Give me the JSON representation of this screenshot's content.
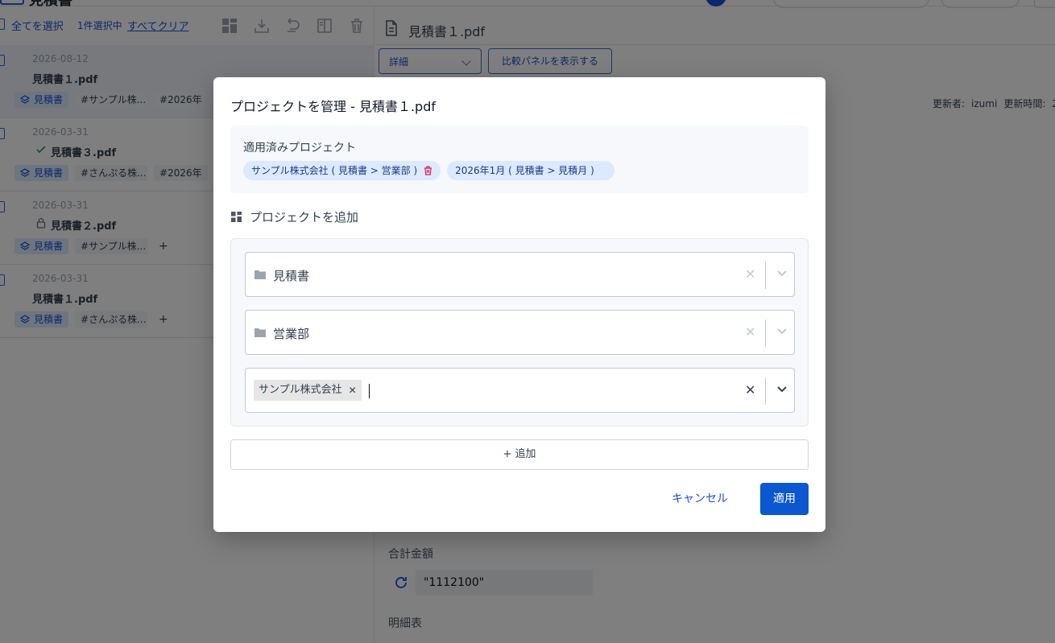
{
  "app": {
    "title": "見積書"
  },
  "left_panel": {
    "select_all": "全てを選択",
    "selected_count": "1件選択中",
    "clear_all": "すべてクリア",
    "rows": [
      {
        "date": "2026-08-12",
        "name": "見積書１.pdf",
        "status": "none",
        "tags": [
          "見積書",
          "#サンプル株...",
          "#2026年"
        ],
        "active": true
      },
      {
        "date": "2026-03-31",
        "name": "見積書３.pdf",
        "status": "check",
        "tags": [
          "見積書",
          "#さんぷる株...",
          "#2026年"
        ],
        "active": false
      },
      {
        "date": "2026-03-31",
        "name": "見積書２.pdf",
        "status": "lock",
        "tags": [
          "見積書",
          "#サンプル株..."
        ],
        "plus": "+",
        "active": false
      },
      {
        "date": "2026-03-31",
        "name": "見積書１.pdf",
        "status": "none",
        "tags": [
          "見積書",
          "#さんぷる株..."
        ],
        "plus": "+",
        "active": false
      }
    ]
  },
  "right_panel": {
    "file_title": "見積書１.pdf",
    "view_select": "詳細",
    "compare_button": "比較パネルを表示する",
    "updater_label": "更新者:",
    "updater": "izumi",
    "updated_label": "更新時間:",
    "updated_value": "2",
    "total_label": "合計金額",
    "total_value": "\"1112100\"",
    "detail_label": "明細表"
  },
  "modal": {
    "title": "プロジェクトを管理 - 見積書１.pdf",
    "applied_label": "適用済みプロジェクト",
    "applied_chips": [
      "サンプル株式会社 ( 見積書 > 営業部 )",
      "2026年1月 ( 見積書 > 見積月 )"
    ],
    "add_heading": "プロジェクトを追加",
    "selects": [
      "見積書",
      "営業部"
    ],
    "multi_tag": "サンプル株式会社",
    "add_button": "+  追加",
    "cancel": "キャンセル",
    "apply": "適用",
    "colors": {
      "primary": "#0b57d0",
      "chip_bg": "#dbeafe",
      "delete": "#e11d48"
    }
  }
}
